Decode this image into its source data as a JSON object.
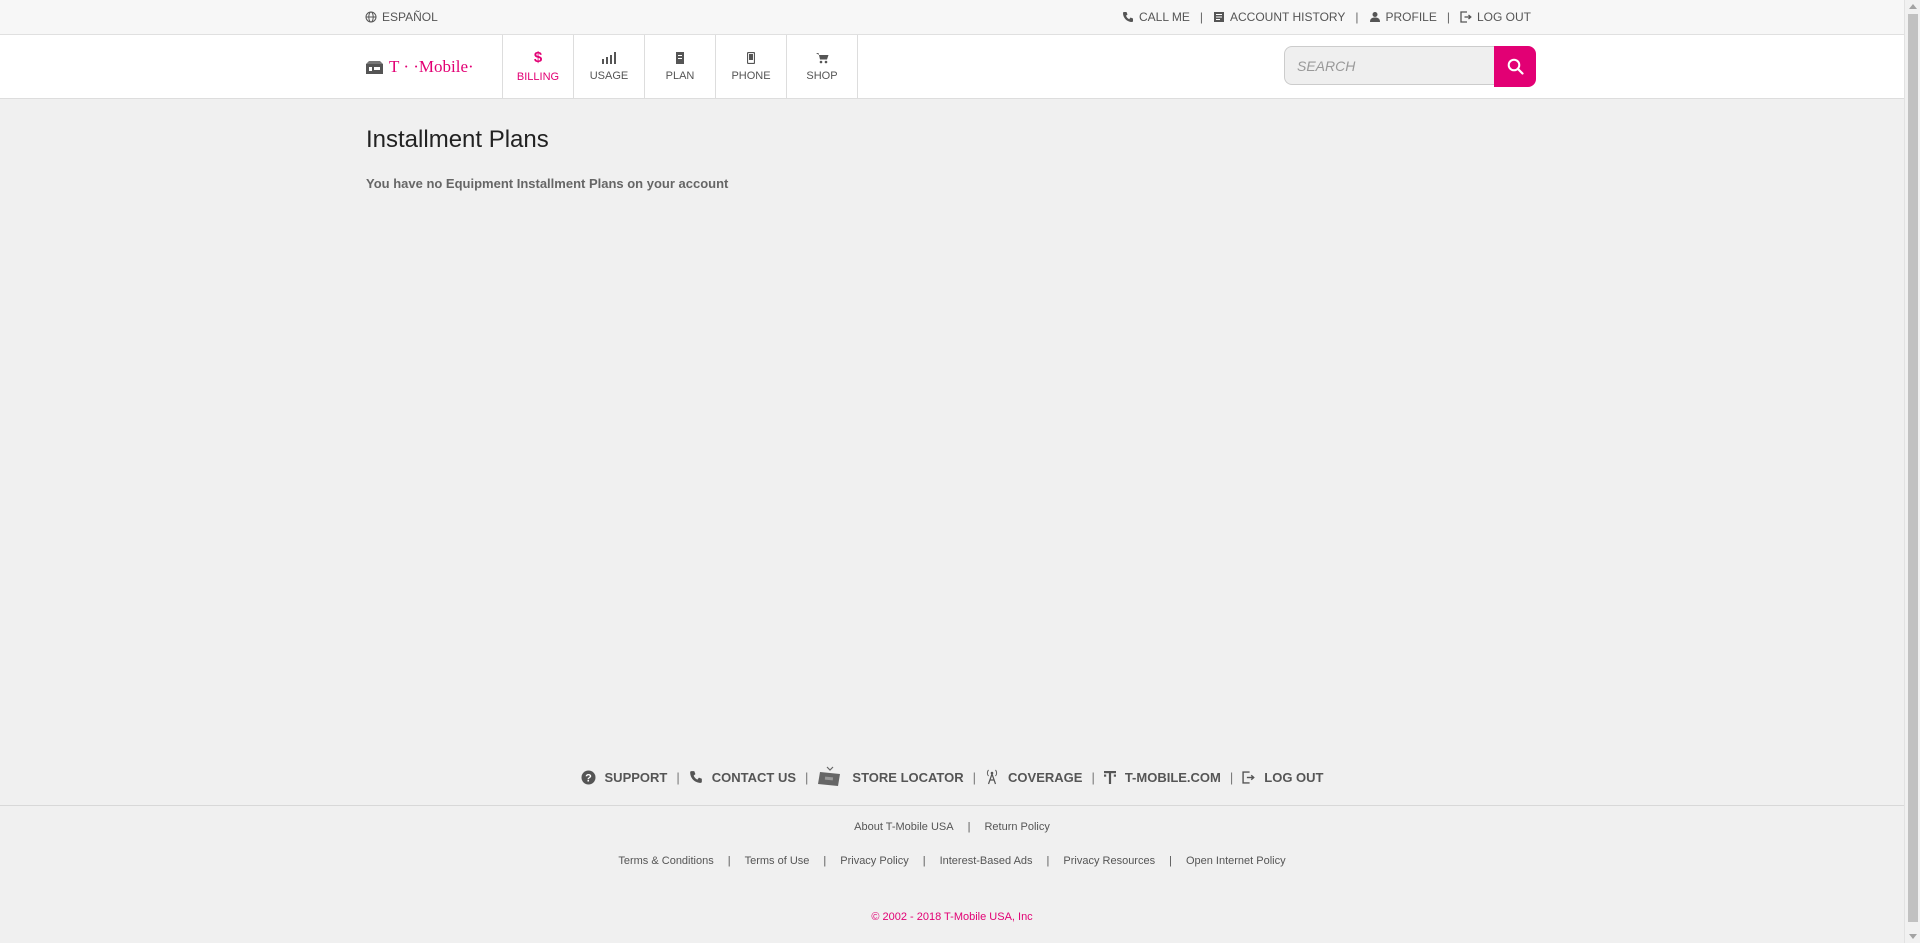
{
  "topbar": {
    "language_label": "ESPAÑOL",
    "links": {
      "call_me": "CALL ME",
      "account_history": "ACCOUNT HISTORY",
      "profile": "PROFILE",
      "log_out": "LOG OUT"
    },
    "separator": "|"
  },
  "header": {
    "logo_text": "T · ·Mobile·",
    "nav": {
      "billing": {
        "label": "BILLING",
        "icon": "$"
      },
      "usage": {
        "label": "USAGE"
      },
      "plan": {
        "label": "PLAN"
      },
      "phone": {
        "label": "PHONE"
      },
      "shop": {
        "label": "SHOP"
      }
    },
    "search": {
      "placeholder": "SEARCH"
    }
  },
  "main": {
    "title": "Installment Plans",
    "message": "You have no Equipment Installment Plans on your account"
  },
  "footer": {
    "links": {
      "support": "SUPPORT",
      "contact_us": "CONTACT US",
      "store_locator": "STORE LOCATOR",
      "coverage": "COVERAGE",
      "tmobile_com": "T-MOBILE.COM",
      "log_out": "LOG OUT"
    },
    "legal_row1": {
      "about": "About T-Mobile USA",
      "return_policy": "Return Policy"
    },
    "legal_row2": {
      "terms_conditions": "Terms & Conditions",
      "terms_of_use": "Terms of Use",
      "privacy_policy": "Privacy Policy",
      "interest_ads": "Interest-Based Ads",
      "privacy_resources": "Privacy Resources",
      "open_internet": "Open Internet Policy"
    },
    "copyright": "© 2002 - 2018 T-Mobile USA, Inc"
  },
  "colors": {
    "brand": "#e20074",
    "background": "#f0f0f0",
    "text": "#555555"
  }
}
